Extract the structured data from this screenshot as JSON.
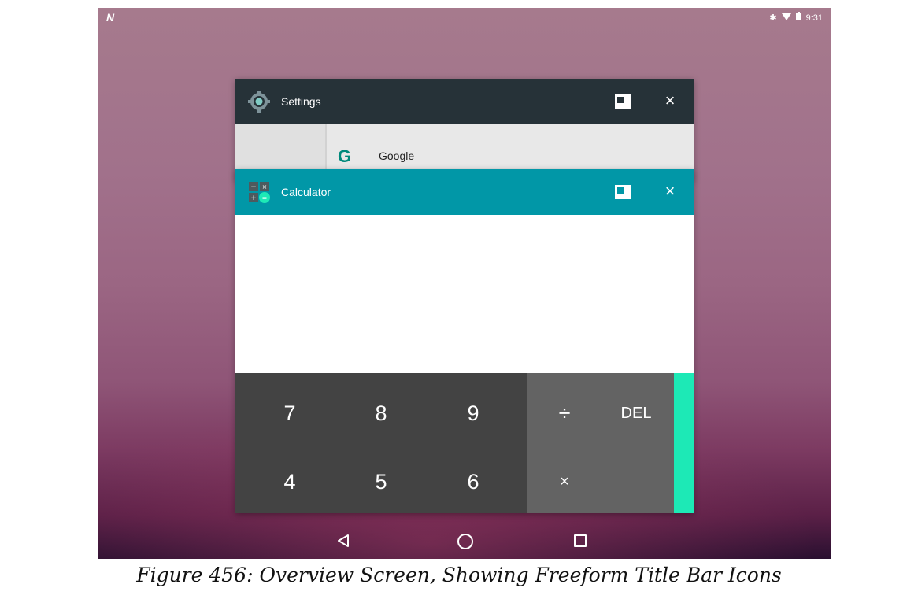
{
  "statusbar": {
    "logo": "N",
    "time": "9:31",
    "icons": [
      "bluetooth-icon",
      "wifi-icon",
      "battery-icon"
    ]
  },
  "settings_window": {
    "title": "Settings",
    "content_item": "Google",
    "content_icon_letter": "G",
    "close_glyph": "×"
  },
  "calculator_window": {
    "title": "Calculator",
    "close_glyph": "×",
    "keys": {
      "k7": "7",
      "k8": "8",
      "k9": "9",
      "k4": "4",
      "k5": "5",
      "k6": "6",
      "divide": "÷",
      "multiply": "×",
      "del": "DEL"
    }
  },
  "caption": "Figure 456: Overview Screen, Showing Freeform Title Bar Icons",
  "colors": {
    "settings_titlebar": "#263238",
    "calculator_titlebar": "#0197a7",
    "calculator_accent": "#1de9b6",
    "number_pad": "#434343",
    "operator_pad": "#636363"
  }
}
